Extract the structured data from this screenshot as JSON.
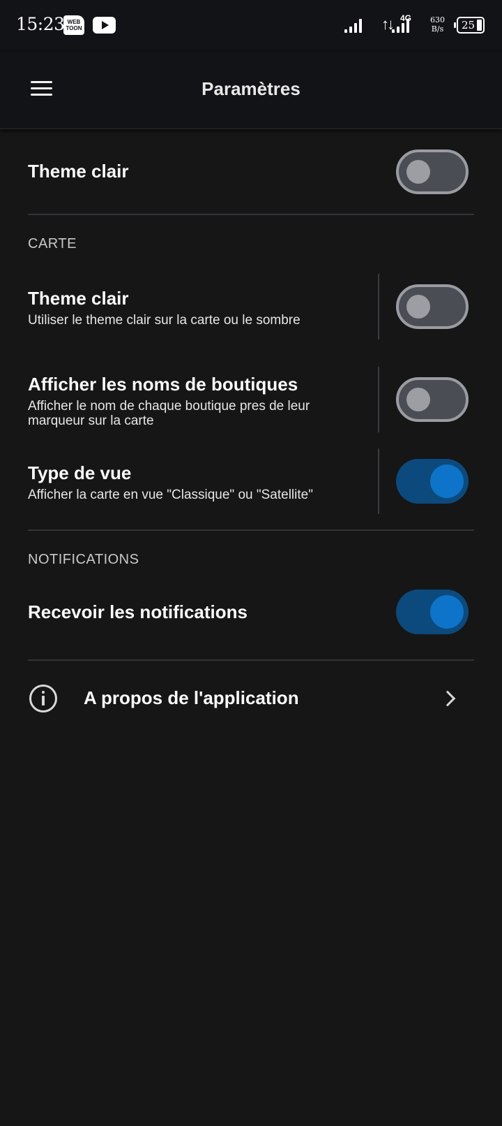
{
  "status_bar": {
    "time": "15:23",
    "webtoon_label": "WEB TOON",
    "network": "4G",
    "speed_value": "630",
    "speed_unit": "B/s",
    "battery": "25"
  },
  "app_bar": {
    "title": "Paramètres"
  },
  "general": {
    "theme": {
      "label": "Theme clair",
      "enabled": false
    }
  },
  "carte": {
    "header": "CARTE",
    "items": [
      {
        "title": "Theme clair",
        "subtitle": "Utiliser le theme clair sur la carte ou le sombre",
        "enabled": false
      },
      {
        "title": "Afficher les noms de boutiques",
        "subtitle": "Afficher le nom de chaque boutique pres de leur marqueur sur la carte",
        "enabled": false
      },
      {
        "title": "Type de vue",
        "subtitle": "Afficher la carte en vue \"Classique\" ou \"Satellite\"",
        "enabled": true
      }
    ]
  },
  "notifications": {
    "header": "NOTIFICATIONS",
    "receive": {
      "label": "Recevoir les notifications",
      "enabled": true
    }
  },
  "about": {
    "label": "A propos de l'application"
  },
  "colors": {
    "background": "#161617",
    "toggle_on_track": "#0c4a7d",
    "toggle_on_knob": "#0d74c9",
    "toggle_off_track": "#4a4d54"
  }
}
